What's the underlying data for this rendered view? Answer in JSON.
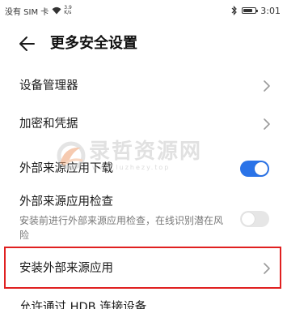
{
  "status_bar": {
    "carrier": "没有 SIM 卡",
    "speed_value": "3.9",
    "speed_unit": "K/s",
    "time": "3:01",
    "battery_level": 0.8
  },
  "header": {
    "title": "更多安全设置"
  },
  "settings": {
    "device_manager": "设备管理器",
    "encryption": "加密和凭据",
    "external_download": {
      "label": "外部来源应用下载",
      "enabled": true
    },
    "external_check": {
      "label": "外部来源应用检查",
      "description": "安装前进行外部来源应用检查，在线识别潜在风险",
      "enabled": false
    },
    "install_external": "安装外部来源应用",
    "partial_next": "允许通过 HDB 连接设备"
  },
  "watermark": {
    "text": "录哲资源网",
    "url": "www.luzhezy.top"
  },
  "colors": {
    "toggle_on": "#2a73e8",
    "toggle_off": "#e6e6e6",
    "highlight": "#e02020"
  }
}
